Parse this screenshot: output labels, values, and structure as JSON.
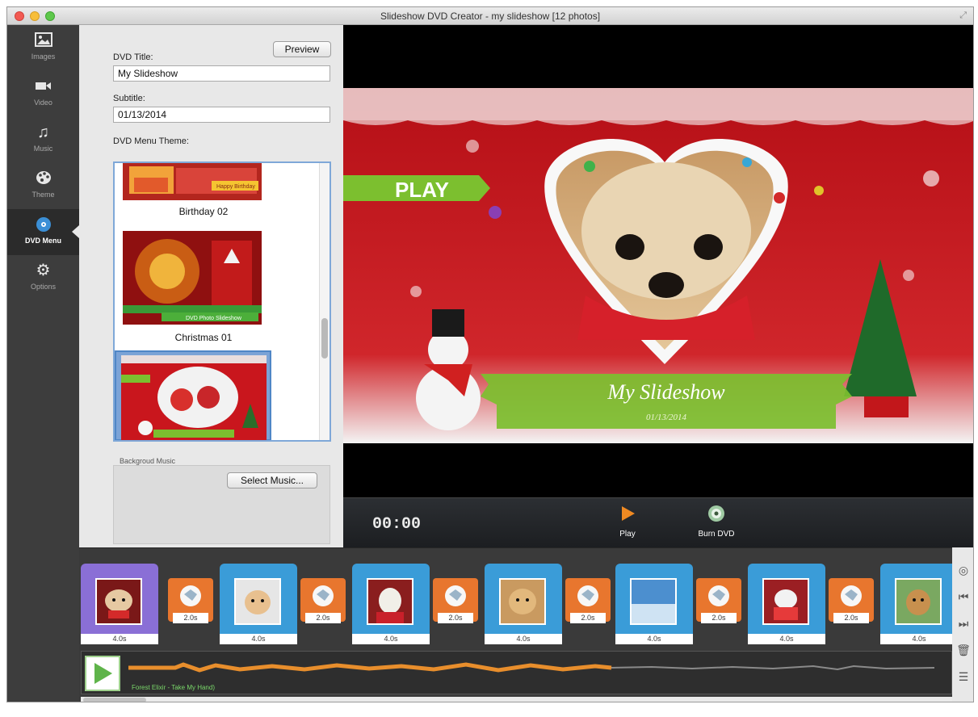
{
  "window": {
    "title": "Slideshow DVD Creator - my slideshow [12 photos]"
  },
  "sidebar": {
    "items": [
      {
        "label": "Images",
        "icon": "image-icon"
      },
      {
        "label": "Video",
        "icon": "video-camera-icon"
      },
      {
        "label": "Music",
        "icon": "music-note-icon"
      },
      {
        "label": "Theme",
        "icon": "palette-icon"
      },
      {
        "label": "DVD Menu",
        "icon": "dvd-icon",
        "active": true
      },
      {
        "label": "Options",
        "icon": "gear-icon"
      }
    ]
  },
  "panel": {
    "preview_button": "Preview",
    "dvd_title_label": "DVD Title:",
    "dvd_title_value": "My Slideshow",
    "subtitle_label": "Subtitle:",
    "subtitle_value": "01/13/2014",
    "menu_theme_label": "DVD Menu Theme:",
    "themes": [
      {
        "name": "Birthday 02"
      },
      {
        "name": "Christmas 01"
      },
      {
        "name": "",
        "selected": true
      }
    ],
    "background_music_label": "Backgroud Music",
    "select_music_button": "Select Music..."
  },
  "preview": {
    "play_label": "PLAY",
    "menu_title": "My Slideshow",
    "menu_date": "01/13/2014"
  },
  "controls": {
    "time": "00:00",
    "play_label": "Play",
    "burn_label": "Burn DVD"
  },
  "timeline": {
    "photos": [
      {
        "dur": "4.0s",
        "color": "#8a6fd6",
        "selected": true
      },
      {
        "dur": "4.0s",
        "color": "#3a9cd8"
      },
      {
        "dur": "4.0s",
        "color": "#3a9cd8"
      },
      {
        "dur": "4.0s",
        "color": "#3a9cd8"
      },
      {
        "dur": "4.0s",
        "color": "#3a9cd8"
      },
      {
        "dur": "4.0s",
        "color": "#3a9cd8"
      },
      {
        "dur": "4.0s",
        "color": "#3a9cd8"
      }
    ],
    "transitions": [
      {
        "dur": "2.0s"
      },
      {
        "dur": "2.0s"
      },
      {
        "dur": "2.0s"
      },
      {
        "dur": "2.0s"
      },
      {
        "dur": "2.0s"
      },
      {
        "dur": "2.0s"
      }
    ],
    "track_name": "Forest Elixir - Take My Hand)"
  },
  "colors": {
    "accent_orange": "#e8762e",
    "selection_blue": "#3a9cd8",
    "menu_red": "#c8141c",
    "ribbon_green": "#7cbf2f"
  }
}
